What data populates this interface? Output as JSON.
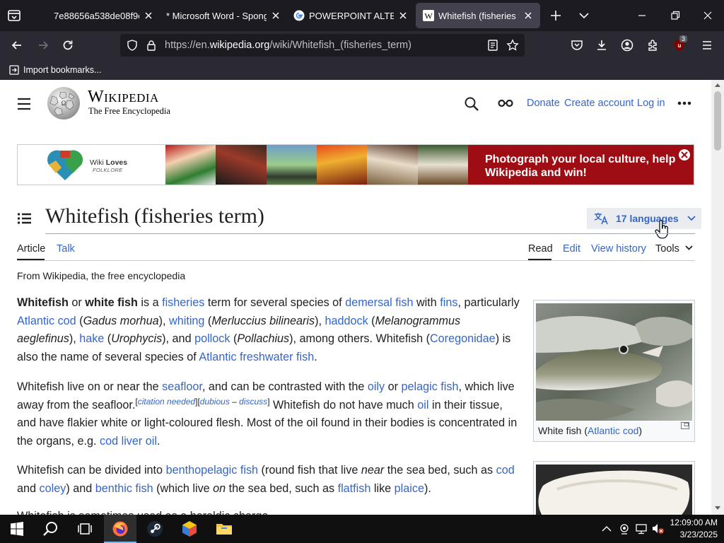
{
  "browser": {
    "tabs": [
      {
        "title": "7e88656a538de08f9ee"
      },
      {
        "title": "* Microsoft Word - Sponge"
      },
      {
        "title": "POWERPOINT ALTERNA"
      },
      {
        "title": "Whitefish (fisheries term"
      }
    ],
    "url": {
      "prefix": "https://en.",
      "domain": "wikipedia.org",
      "path": "/wiki/Whitefish_(fisheries_term)"
    },
    "extension_badge": "3",
    "bookmarks": [
      {
        "label": "Import bookmarks..."
      }
    ]
  },
  "wiki": {
    "wordmark": "Wikipedia",
    "tagline": "The Free Encyclopedia",
    "header_links": [
      "Donate",
      "Create account",
      "Log in"
    ],
    "banner": {
      "logo_line1a": "Wiki ",
      "logo_line1b": "Loves",
      "logo_line2": "FOLKLORE",
      "line1": "Photograph your local culture, help",
      "line2": "Wikipedia and win!"
    },
    "title": "Whitefish (fisheries term)",
    "languages": "17 languages",
    "tabs_left": [
      "Article",
      "Talk"
    ],
    "tabs_right": [
      "Read",
      "Edit",
      "View history",
      "Tools"
    ],
    "from": "From Wikipedia, the free encyclopedia",
    "infobox_caption_pre": "White fish (",
    "infobox_caption_link": "Atlantic cod",
    "infobox_caption_post": ")"
  },
  "taskbar": {
    "time": "12:09:00 AM",
    "date": "3/23/2025"
  },
  "colors": {
    "link": "#3366cc",
    "banner": "#9e0d13",
    "text": "#202122"
  }
}
